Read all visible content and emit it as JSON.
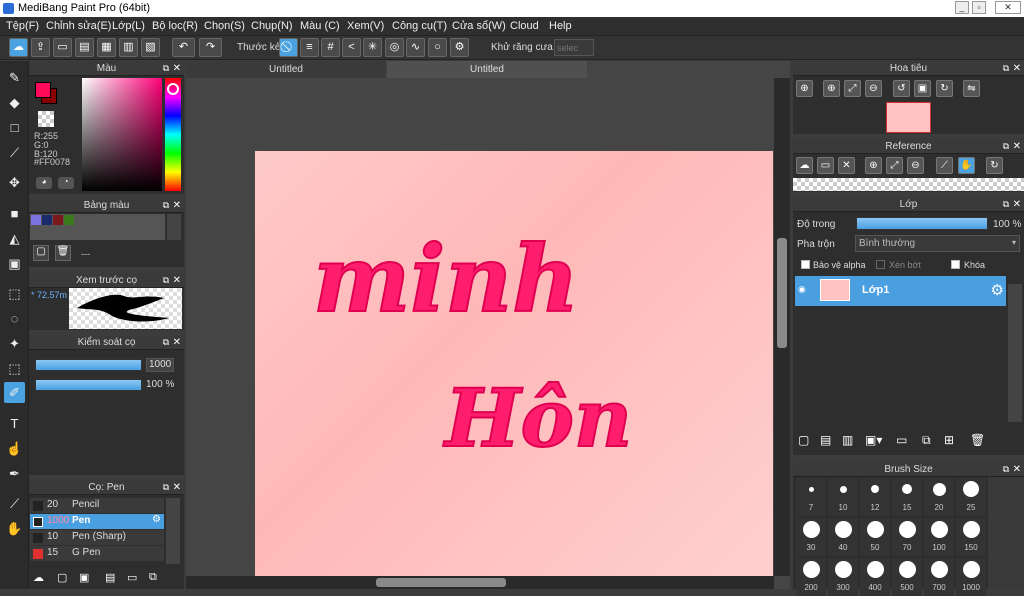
{
  "titlebar": {
    "title": "MediBang Paint Pro (64bit)"
  },
  "menu": [
    "Tệp(F)",
    "Chỉnh sửa(E)",
    "Lớp(L)",
    "Bộ lọc(R)",
    "Chọn(S)",
    "Chụp(N)",
    "Màu (C)",
    "Xem(V)",
    "Công cụ(T)",
    "Cửa sổ(W)",
    "Cloud",
    "Help"
  ],
  "toolbar": {
    "ruler_label": "Thước kẻ",
    "antialias_label": "Khử răng cưa",
    "select_placeholder": "selec"
  },
  "color_panel": {
    "title": "Màu",
    "r": "R:255",
    "g": "G:0",
    "b": "B:120",
    "hex": "#FF0078",
    "primary_color": "#ff0a5a"
  },
  "palette_panel": {
    "title": "Bảng màu",
    "dashes": "---",
    "swatches": [
      "#7b73e0",
      "#1a2a6a",
      "#7a1a1a",
      "#3a7a1a"
    ]
  },
  "preview_panel": {
    "title": "Xem trước cọ",
    "size": "* 72.57m"
  },
  "brush_control": {
    "title": "Kiểm soát cọ",
    "size_value": "1000",
    "opacity_value": "100 %"
  },
  "brush_panel": {
    "title": "Cọ: Pen",
    "items": [
      {
        "size": "20",
        "name": "Pencil",
        "color": "#222"
      },
      {
        "size": "1000",
        "name": "Pen",
        "color": "#222"
      },
      {
        "size": "10",
        "name": "Pen (Sharp)",
        "color": "#222"
      },
      {
        "size": "15",
        "name": "G Pen",
        "color": "#e03030"
      }
    ]
  },
  "tabs": [
    "Untitled",
    "Untitled"
  ],
  "canvas": {
    "word1": "minh",
    "word2": "Hôn"
  },
  "nav_panel": {
    "title": "Hoa tiêu"
  },
  "reference_panel": {
    "title": "Reference"
  },
  "layer_panel": {
    "title": "Lớp",
    "opacity_label": "Độ trong",
    "opacity_value": "100 %",
    "blend_label": "Pha trộn",
    "blend_value": "Bình thường",
    "protect_alpha": "Bảo vệ alpha",
    "clip": "Xén bớt",
    "lock": "Khóa",
    "layer_name": "Lớp1"
  },
  "brushsize_panel": {
    "title": "Brush Size",
    "sizes": [
      "7",
      "10",
      "12",
      "15",
      "20",
      "25",
      "30",
      "40",
      "50",
      "70",
      "100",
      "150",
      "200",
      "300",
      "400",
      "500",
      "700",
      "1000"
    ]
  }
}
